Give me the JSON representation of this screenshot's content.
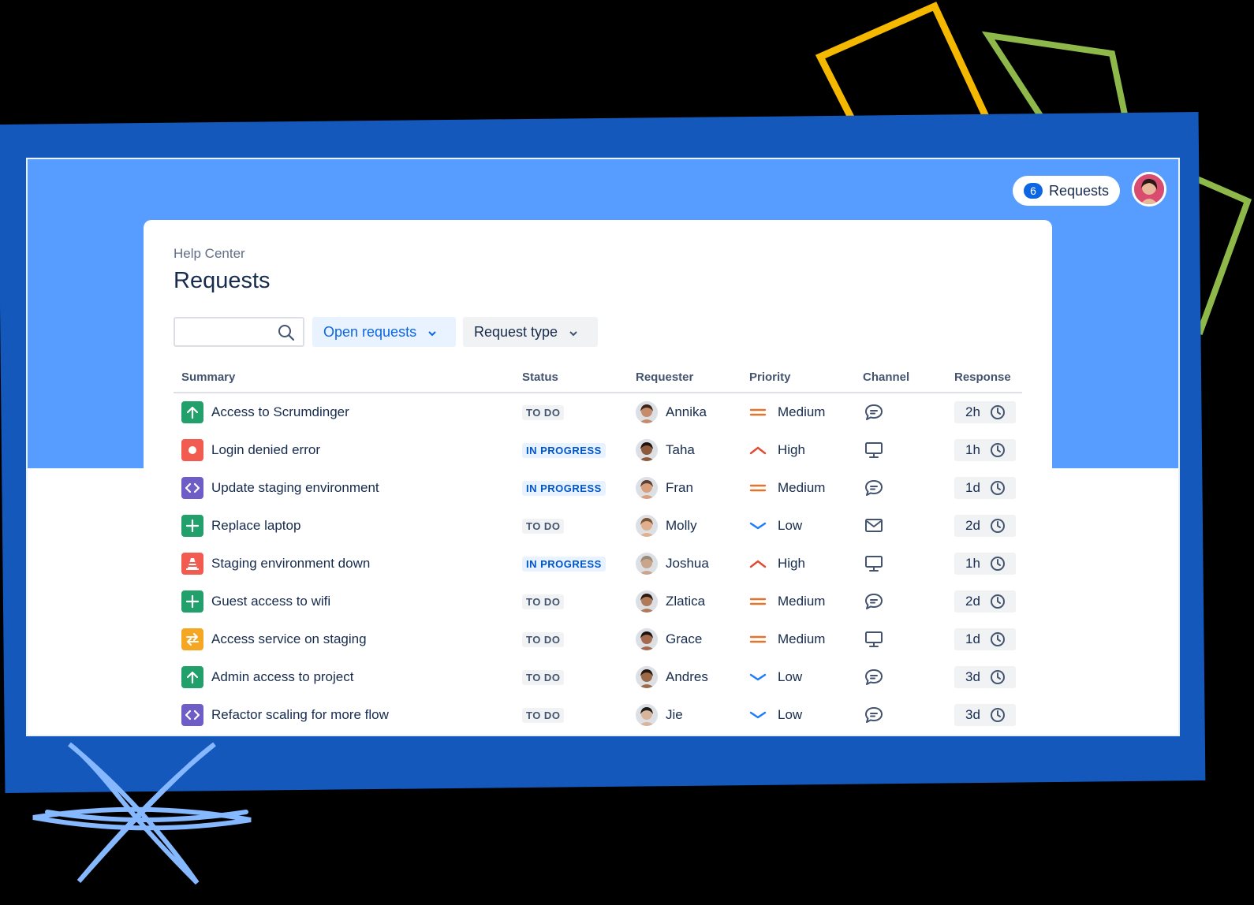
{
  "header": {
    "requests_count": "6",
    "requests_label": "Requests"
  },
  "page": {
    "breadcrumb": "Help Center",
    "title": "Requests"
  },
  "search": {
    "placeholder": "",
    "value": ""
  },
  "filters": {
    "open_requests": "Open requests",
    "request_type": "Request type"
  },
  "table": {
    "columns": {
      "summary": "Summary",
      "status": "Status",
      "requester": "Requester",
      "priority": "Priority",
      "channel": "Channel",
      "response": "Response"
    },
    "rows": [
      {
        "summary": "Access to Scrumdinger",
        "type_icon": "arrow-up-icon",
        "type_color": "#22A06B",
        "status": "TO DO",
        "requester": "Annika",
        "priority": "Medium",
        "channel": "chat-icon",
        "response": "2h"
      },
      {
        "summary": "Login denied error",
        "type_icon": "dot-icon",
        "type_color": "#F15B50",
        "status": "IN PROGRESS",
        "requester": "Taha",
        "priority": "High",
        "channel": "monitor-icon",
        "response": "1h"
      },
      {
        "summary": "Update staging environment",
        "type_icon": "code-icon",
        "type_color": "#6E5DC6",
        "status": "IN PROGRESS",
        "requester": "Fran",
        "priority": "Medium",
        "channel": "chat-icon",
        "response": "1d"
      },
      {
        "summary": "Replace laptop",
        "type_icon": "plus-icon",
        "type_color": "#22A06B",
        "status": "TO DO",
        "requester": "Molly",
        "priority": "Low",
        "channel": "mail-icon",
        "response": "2d"
      },
      {
        "summary": "Staging environment down",
        "type_icon": "cone-icon",
        "type_color": "#F15B50",
        "status": "IN PROGRESS",
        "requester": "Joshua",
        "priority": "High",
        "channel": "monitor-icon",
        "response": "1h"
      },
      {
        "summary": "Guest access to wifi",
        "type_icon": "plus-icon",
        "type_color": "#22A06B",
        "status": "TO DO",
        "requester": "Zlatica",
        "priority": "Medium",
        "channel": "chat-icon",
        "response": "2d"
      },
      {
        "summary": "Access service on staging",
        "type_icon": "swap-icon",
        "type_color": "#F5A623",
        "status": "TO DO",
        "requester": "Grace",
        "priority": "Medium",
        "channel": "monitor-icon",
        "response": "1d"
      },
      {
        "summary": "Admin access to project",
        "type_icon": "arrow-up-icon",
        "type_color": "#22A06B",
        "status": "TO DO",
        "requester": "Andres",
        "priority": "Low",
        "channel": "chat-icon",
        "response": "3d"
      },
      {
        "summary": "Refactor scaling for more flow",
        "type_icon": "code-icon",
        "type_color": "#6E5DC6",
        "status": "TO DO",
        "requester": "Jie",
        "priority": "Low",
        "channel": "chat-icon",
        "response": "3d"
      }
    ]
  },
  "colors": {
    "backdrop": "#1558BC",
    "header_band": "#579DFF",
    "accent": "#0C66E4",
    "deco_yellow": "#F5B800",
    "deco_green": "#8FB84A",
    "deco_star": "#85B8FF"
  }
}
